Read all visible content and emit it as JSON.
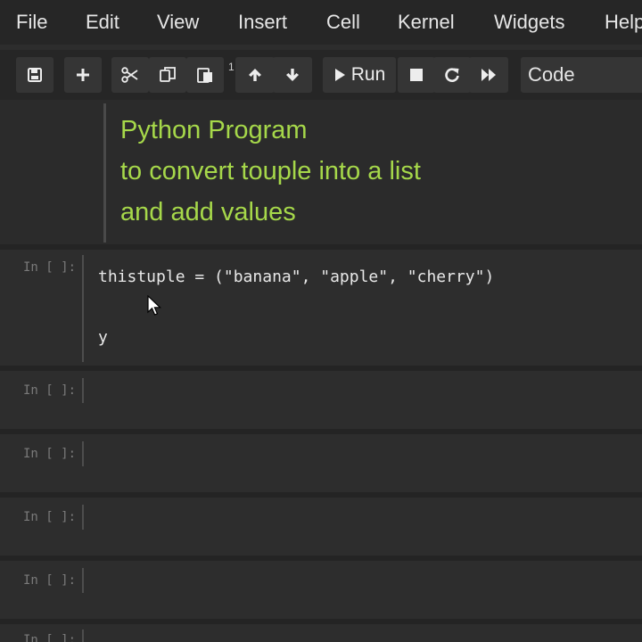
{
  "menubar": {
    "items": [
      "File",
      "Edit",
      "View",
      "Insert",
      "Cell",
      "Kernel",
      "Widgets",
      "Help"
    ]
  },
  "toolbar": {
    "save_icon": "save-icon",
    "add_icon": "plus-icon",
    "cut_icon": "scissors-icon",
    "copy_icon": "copy-icon",
    "paste_icon": "paste-icon",
    "badge": "1",
    "move_up_icon": "arrow-up-icon",
    "move_down_icon": "arrow-down-icon",
    "run_label": "Run",
    "stop_icon": "stop-icon",
    "restart_icon": "restart-icon",
    "fast_forward_icon": "fast-forward-icon",
    "cell_type": "Code"
  },
  "markdown_cell": {
    "lines": [
      "Python Program",
      "to convert touple into a list",
      "and add values"
    ]
  },
  "code_cells": [
    {
      "prompt": "In [ ]:",
      "lines": [
        "thistuple = (\"banana\", \"apple\", \"cherry\")",
        "",
        "y"
      ]
    },
    {
      "prompt": "In [ ]:",
      "lines": []
    },
    {
      "prompt": "In [ ]:",
      "lines": []
    },
    {
      "prompt": "In [ ]:",
      "lines": []
    },
    {
      "prompt": "In [ ]:",
      "lines": []
    },
    {
      "prompt": "In [ ]:",
      "lines": []
    }
  ],
  "colors": {
    "markdown_text": "#a6d84a",
    "background": "#2d2d2d",
    "toolbar": "#262626"
  }
}
